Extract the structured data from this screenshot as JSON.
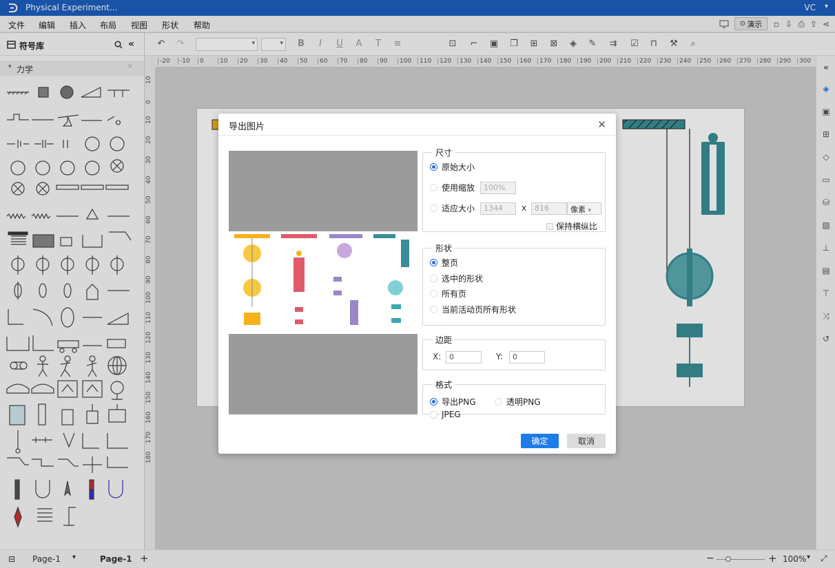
{
  "app": {
    "title": "Physical Experiment...",
    "user": "VC"
  },
  "menu": [
    "文件",
    "编辑",
    "插入",
    "布局",
    "视图",
    "形状",
    "帮助"
  ],
  "present_label": "演示",
  "library": {
    "title": "符号库",
    "category": "力学"
  },
  "ruler": {
    "h": [
      "-20",
      "-10",
      "0",
      "10",
      "20",
      "30",
      "40",
      "50",
      "60",
      "70",
      "80",
      "90",
      "100",
      "110",
      "120",
      "130",
      "140",
      "150",
      "160",
      "170",
      "180",
      "190",
      "200",
      "210",
      "220",
      "230",
      "240",
      "250",
      "260",
      "270",
      "280",
      "290",
      "300",
      "3"
    ],
    "v": [
      "10",
      "0",
      "10",
      "20",
      "30",
      "40",
      "50",
      "60",
      "70",
      "80",
      "90",
      "100",
      "110",
      "120",
      "130",
      "140",
      "150",
      "160",
      "170",
      "180"
    ]
  },
  "dialog": {
    "title": "导出图片",
    "size": {
      "legend": "尺寸",
      "original": "原始大小",
      "scale": "使用缩放",
      "scale_value": "100%",
      "fit": "适应大小",
      "width": "1344",
      "x": "x",
      "height": "816",
      "unit": "像素",
      "keep_ratio": "保持横纵比"
    },
    "shape": {
      "legend": "形状",
      "whole_page": "整页",
      "selected": "选中的形状",
      "all_pages": "所有页",
      "current_all": "当前活动页所有形状"
    },
    "margin": {
      "legend": "边距",
      "x_label": "X:",
      "x_value": "0",
      "y_label": "Y:",
      "y_value": "0"
    },
    "format": {
      "legend": "格式",
      "png": "导出PNG",
      "transparent": "透明PNG",
      "jpeg": "JPEG"
    },
    "ok": "确定",
    "cancel": "取消"
  },
  "status": {
    "page_tab": "Page-1",
    "active_page": "Page-1",
    "zoom": "100%"
  },
  "colors": {
    "accent": "#1e7ce8",
    "titlebar": "#1d5fbf",
    "teal": "#3a8f96"
  }
}
